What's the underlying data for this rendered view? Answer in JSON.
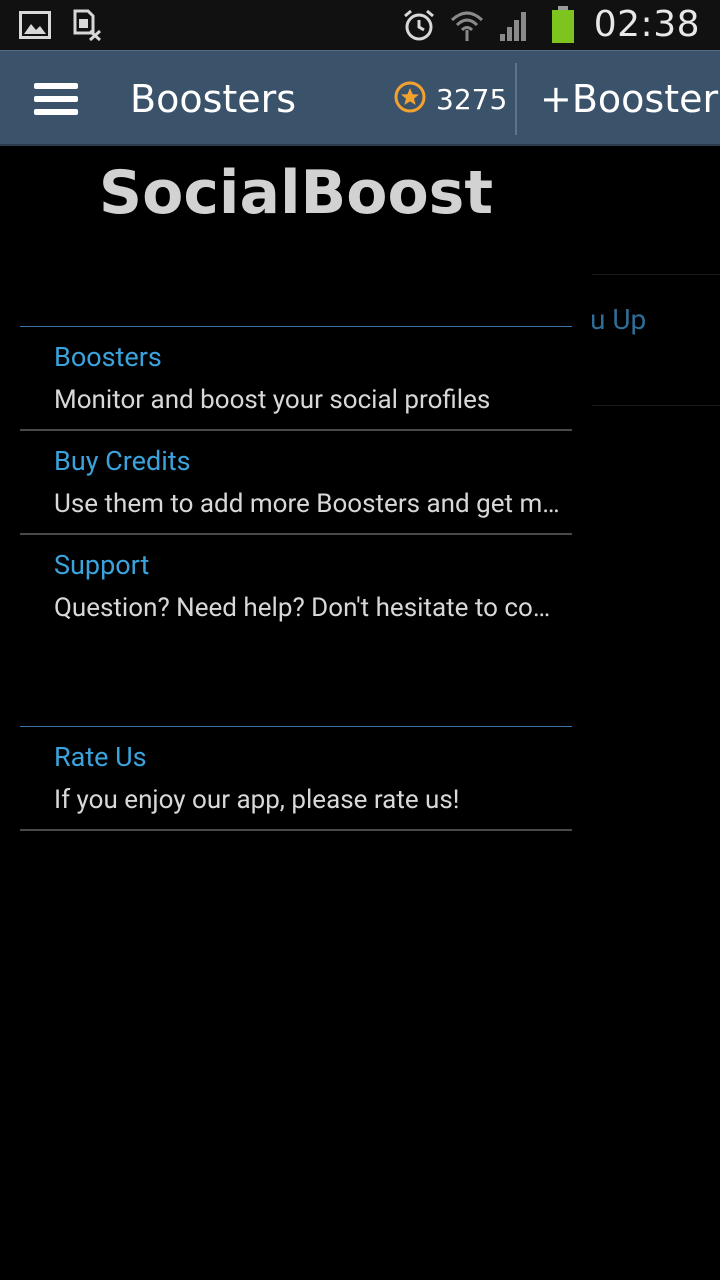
{
  "status_bar": {
    "time": "02:38",
    "icons": [
      "gallery-icon",
      "sim-x-icon",
      "alarm-icon",
      "wifi-icon",
      "signal-icon",
      "battery-icon"
    ]
  },
  "action_bar": {
    "title": "Boosters",
    "credits": "3275",
    "add_button": "+Booster"
  },
  "background": {
    "peek_text": "u Up"
  },
  "drawer": {
    "app_title": "SocialBoost",
    "items": [
      {
        "title": "Boosters",
        "desc": "Monitor and boost your social profiles"
      },
      {
        "title": "Buy Credits",
        "desc": "Use them to add more Boosters and get more"
      },
      {
        "title": "Support",
        "desc": "Question? Need help? Don't hesitate to contact us"
      },
      {
        "title": "Rate Us",
        "desc": "If you enjoy our app, please rate us!"
      }
    ]
  },
  "colors": {
    "action_bar": "#3b526b",
    "accent_blue": "#3aa3dc",
    "star_orange": "#f2a22f",
    "battery_green": "#7dc41e"
  }
}
